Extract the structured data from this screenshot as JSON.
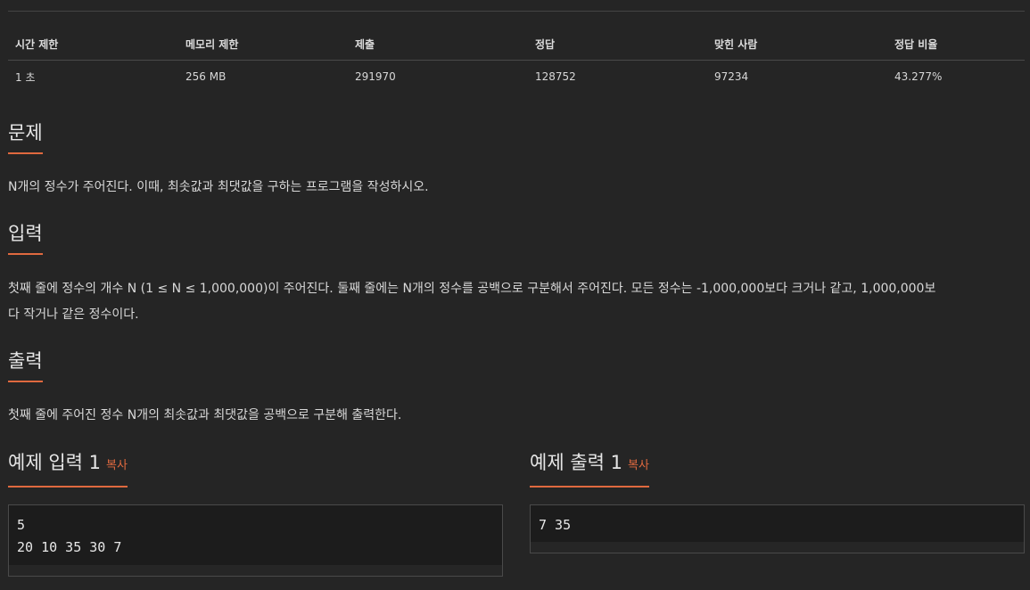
{
  "info_table": {
    "headers": [
      "시간 제한",
      "메모리 제한",
      "제출",
      "정답",
      "맞힌 사람",
      "정답 비율"
    ],
    "values": [
      "1 초",
      "256 MB",
      "291970",
      "128752",
      "97234",
      "43.277%"
    ]
  },
  "problem": {
    "heading": "문제",
    "text": "N개의 정수가 주어진다. 이때, 최솟값과 최댓값을 구하는 프로그램을 작성하시오."
  },
  "input": {
    "heading": "입력",
    "text_line1": "첫째 줄에 정수의 개수 N (1 ≤ N ≤ 1,000,000)이 주어진다. 둘째 줄에는 N개의 정수를 공백으로 구분해서 주어진다. 모든 정수는 -1,000,000보다 크거나 같고, 1,000,000보",
    "text_line2": "다 작거나 같은 정수이다."
  },
  "output": {
    "heading": "출력",
    "text": "첫째 줄에 주어진 정수 N개의 최솟값과 최댓값을 공백으로 구분해 출력한다."
  },
  "sample_input": {
    "heading": "예제 입력 1",
    "copy_label": "복사",
    "lines": [
      "5",
      "20 10 35 30 7"
    ]
  },
  "sample_output": {
    "heading": "예제 출력 1",
    "copy_label": "복사",
    "lines": [
      "7 35"
    ]
  },
  "colors": {
    "accent": "#e0693f",
    "background": "#252525",
    "sample_background": "#1c1c1c"
  }
}
